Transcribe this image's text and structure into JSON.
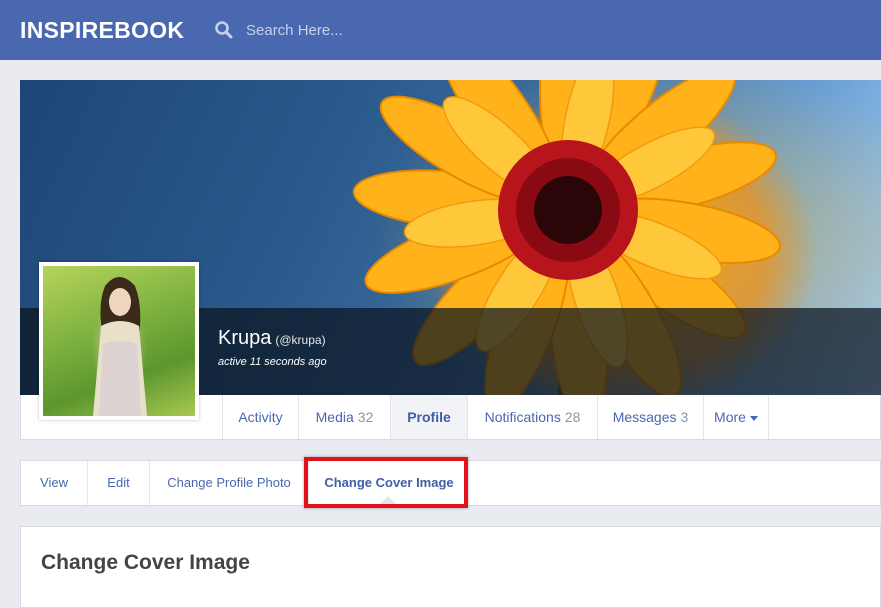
{
  "header": {
    "brand": "INSPIREBOOK",
    "search_placeholder": "Search Here...",
    "search_icon": "search-icon"
  },
  "profile": {
    "name": "Krupa",
    "handle": "(@krupa)",
    "activity": "active 11 seconds ago"
  },
  "profile_nav": [
    {
      "label": "Activity",
      "count": ""
    },
    {
      "label": "Media",
      "count": "32"
    },
    {
      "label": "Profile",
      "count": ""
    },
    {
      "label": "Notifications",
      "count": "28"
    },
    {
      "label": "Messages",
      "count": "3"
    },
    {
      "label": "More",
      "count": ""
    }
  ],
  "profile_sub_nav": [
    {
      "label": "View"
    },
    {
      "label": "Edit"
    },
    {
      "label": "Change Profile Photo"
    },
    {
      "label": "Change Cover Image"
    }
  ],
  "panel": {
    "title": "Change Cover Image"
  },
  "colors": {
    "topbar": "#4a68b0",
    "link": "#4a68b0",
    "highlight": "#e0121a"
  }
}
